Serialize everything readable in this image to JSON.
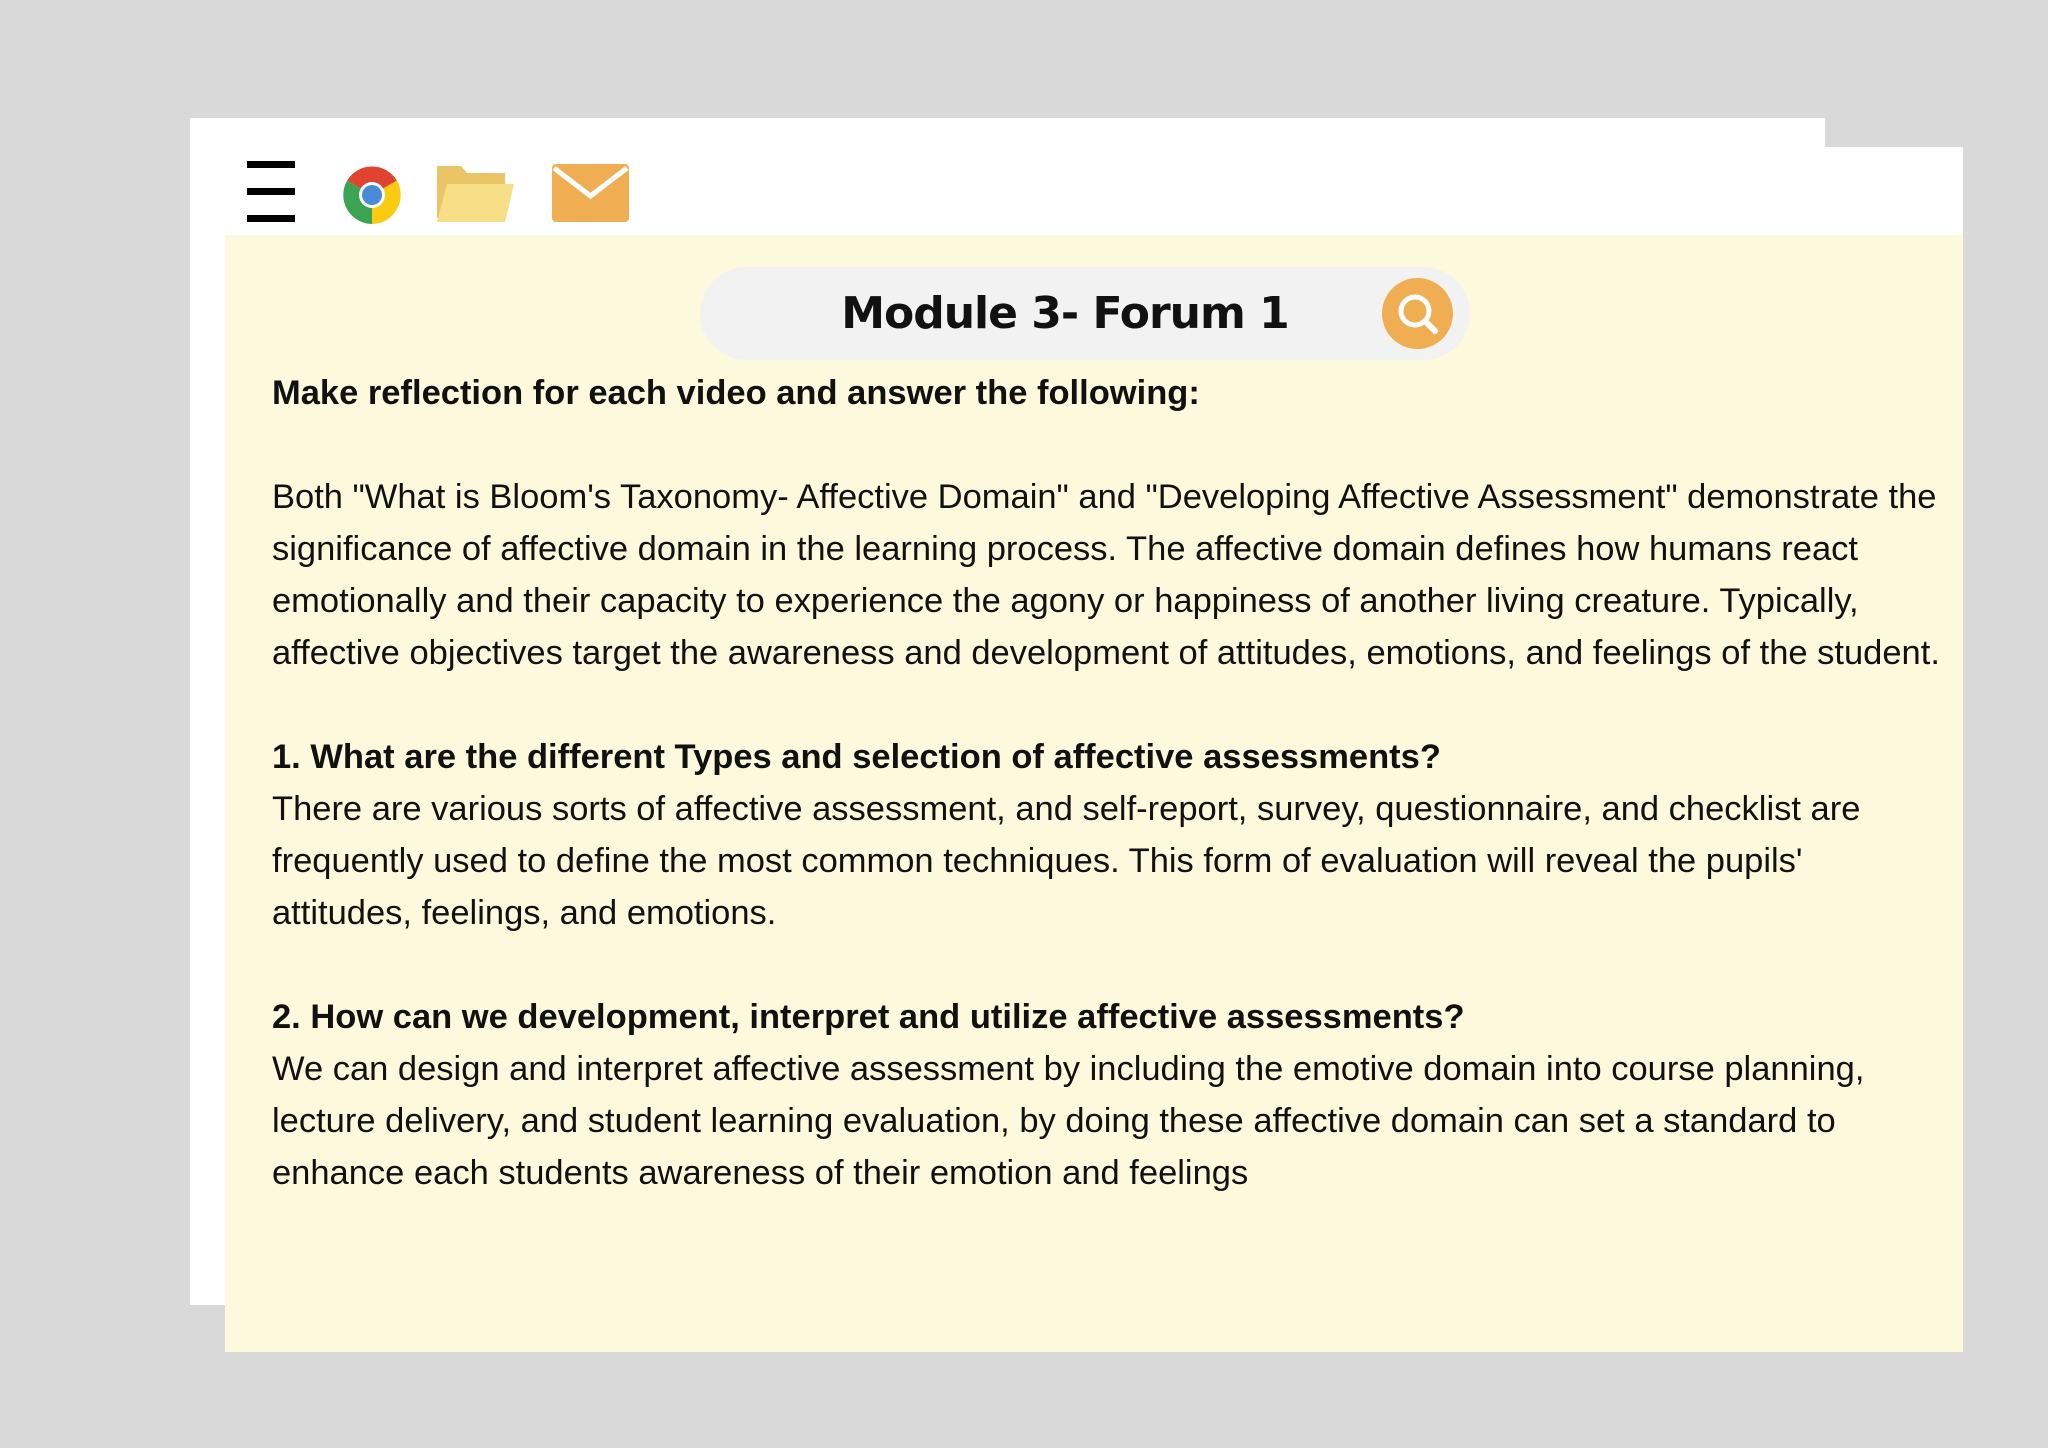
{
  "toolbar": {
    "icons": [
      "menu-icon",
      "chrome-icon",
      "folder-icon",
      "mail-icon"
    ]
  },
  "search": {
    "title": "Module 3- Forum 1"
  },
  "content": {
    "intro_heading": "Make reflection for each video and answer the following:",
    "intro_paragraph": "Both \"What is Bloom's Taxonomy- Affective Domain\" and \"Developing Affective Assessment\" demonstrate the significance of affective domain in the learning process. The affective domain defines how humans react emotionally and their capacity to experience the agony or happiness of another living creature. Typically, affective objectives target the awareness and development of attitudes, emotions, and feelings of the student.",
    "q1_heading": "1. What are the different Types and selection of affective assessments?",
    "q1_answer": "There are various sorts of affective assessment, and self-report, survey, questionnaire, and checklist are frequently used to define the most common techniques. This form of evaluation will reveal the pupils' attitudes, feelings, and emotions.",
    "q2_heading": "2. How can we development, interpret and utilize affective assessments?",
    "q2_answer": "We can design and interpret affective assessment by including the emotive domain into course planning, lecture delivery, and student learning evaluation, by doing these affective domain can set a standard to enhance each students awareness of their emotion and feelings"
  },
  "colors": {
    "background": "#d9d9d9",
    "window": "#fdf9dc",
    "accent": "#efae51",
    "search_bar": "#f2f2f2"
  }
}
